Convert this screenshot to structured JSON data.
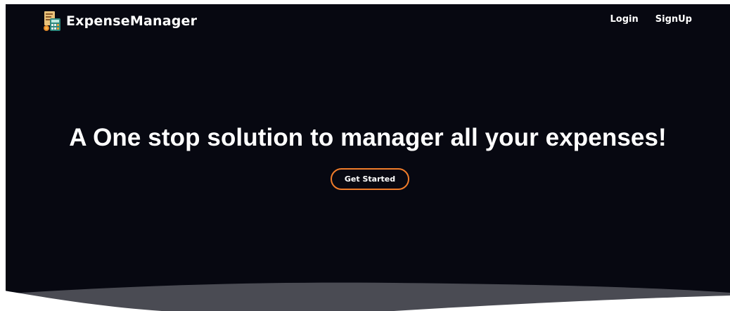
{
  "brand": {
    "name": "ExpenseManager",
    "logo_icon": "calculator-receipt-icon"
  },
  "nav": {
    "login_label": "Login",
    "signup_label": "SignUp"
  },
  "hero": {
    "headline": "A One stop solution to manager all your expenses!",
    "cta_label": "Get Started"
  },
  "colors": {
    "background": "#070811",
    "accent": "#f07c2a",
    "text": "#ffffff",
    "wave": "#4a4b53"
  }
}
